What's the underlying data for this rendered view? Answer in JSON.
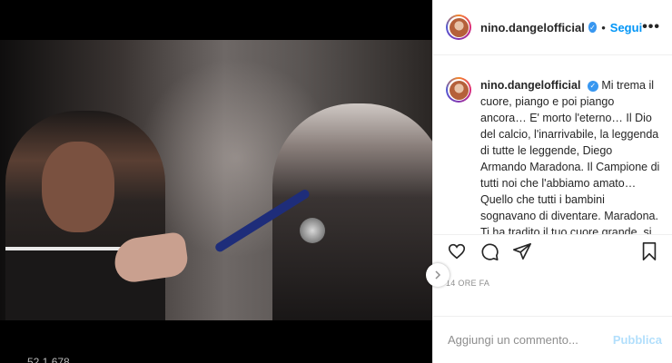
{
  "post": {
    "username": "nino.dangelofficial",
    "follow_label": "Segui",
    "separator": "•",
    "more_label": "•••",
    "caption": "Mi trema il cuore, piango e poi piango ancora… E' morto l'eterno… Il Dio del calcio, l'inarrivabile, la leggenda di tutte le leggende, Diego Armando Maradona. Il Campione di tutti noi che l'abbiamo amato… Quello che tutti i bambini sognavano di diventare. Maradona. Ti ha tradito il tuo cuore grande, si è fermato e ha fatto fermare tutto il mondo. Mi inchino davanti a te, caro",
    "timestamp": "14 ORE FA",
    "comment_placeholder": "Aggiungi un commento...",
    "publish_label": "Pubblica",
    "media_footer": "52     1.678"
  },
  "icons": {
    "verified": "verified-badge-icon",
    "like": "heart-icon",
    "comment": "comment-icon",
    "share": "share-icon",
    "save": "bookmark-icon",
    "next": "chevron-right-icon"
  },
  "colors": {
    "accent": "#0095f6",
    "verified": "#3897f0",
    "publish_disabled": "#b2dffc",
    "muted": "#8e8e8e"
  }
}
